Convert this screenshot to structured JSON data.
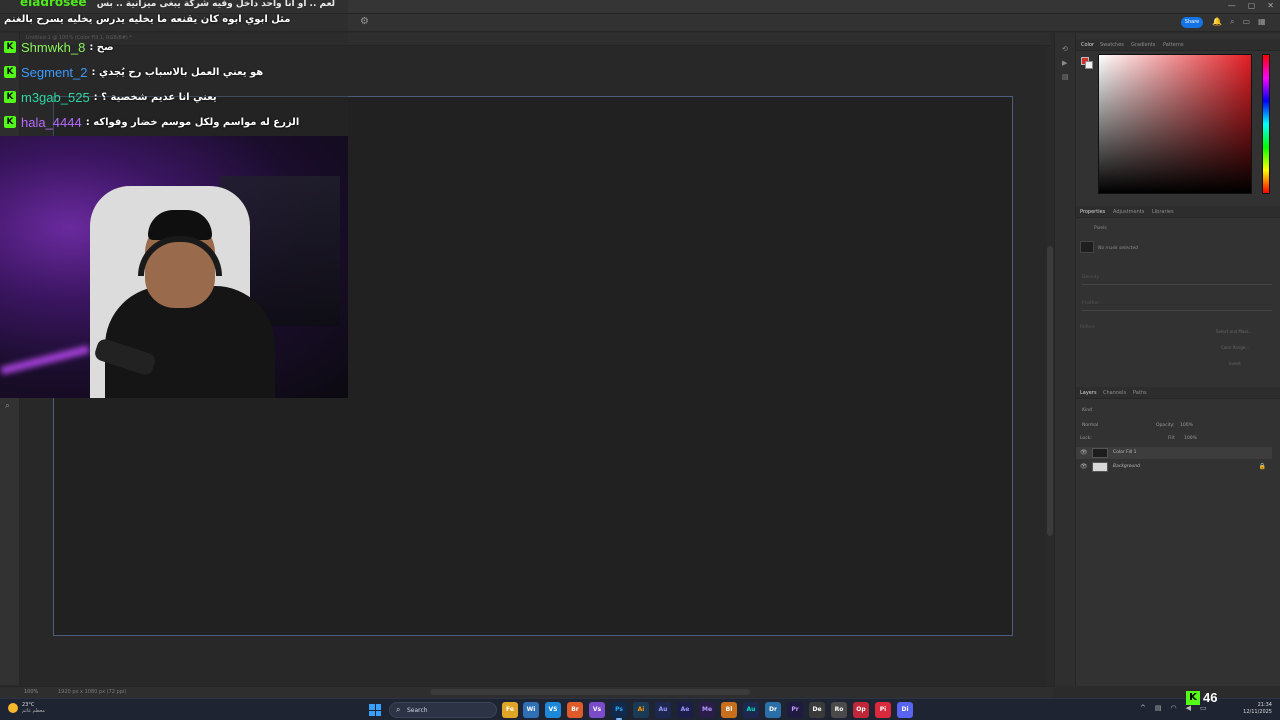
{
  "app": {
    "share_label": "Share",
    "doc_tab": "Untitled-1 @ 100% (Color Fill 1, RGB/8#) *"
  },
  "status": {
    "zoom": "100%",
    "dimensions": "1920 px x 1080 px (72 ppi)"
  },
  "panels": {
    "color_tabs": [
      "Color",
      "Swatches",
      "Gradients",
      "Patterns"
    ],
    "properties_tabs": [
      "Properties",
      "Adjustments",
      "Libraries"
    ],
    "properties_header": "Pixels",
    "no_mask": "No mask selected",
    "density": "Density",
    "feather": "Feather",
    "refine": "Refine:",
    "select_mask": "Select and Mask...",
    "color_range": "Color Range...",
    "invert": "Invert",
    "layers_tabs": [
      "Layers",
      "Channels",
      "Paths"
    ],
    "kind": "Kind",
    "blend_mode": "Normal",
    "opacity_label": "Opacity:",
    "opacity_value": "100%",
    "lock_label": "Lock:",
    "fill_label": "Fill:",
    "fill_value": "100%",
    "layers": [
      {
        "name": "Color Fill 1",
        "selected": true
      },
      {
        "name": "Background",
        "selected": false
      }
    ]
  },
  "chat": {
    "cut_top": "eladrosee",
    "cut_top_text": "لعم .. أو انا واحد داخل وفيه شركة يبغى ميزانية .. بس",
    "partial": "مثل ابوي ابوه كان يقنعه ما يخليه يدرس يخليه يسرح بالغنم",
    "messages": [
      {
        "user": "Shmwkh_8",
        "color": "#8bf25b",
        "text": ": صح"
      },
      {
        "user": "Segment_2",
        "color": "#3a9bff",
        "text": ": هو يعني العمل بالاسباب رح يُجدي"
      },
      {
        "user": "m3gab_525",
        "color": "#2fd6a3",
        "text": ": يعني انا عديم شخصية ؟"
      },
      {
        "user": "hala_4444",
        "color": "#b56bff",
        "text": ": الزرع له مواسم ولكل موسم خضار وفواكه"
      }
    ]
  },
  "taskbar": {
    "temperature": "23°C",
    "condition": "معظم غائم",
    "search_placeholder": "Search",
    "apps": [
      "Fe",
      "Wi",
      "VS",
      "Br",
      "Vs",
      "Ps",
      "Ai",
      "Au",
      "Ae",
      "Me",
      "Bl",
      "Au",
      "Dr",
      "Pr",
      "De",
      "Ro",
      "Op",
      "Pi",
      "Di"
    ],
    "time": "21:34",
    "date": "12/11/2025",
    "kick_viewers": "46"
  },
  "colors": {
    "kick_green": "#53fc18",
    "share_blue": "#1473e6",
    "fg_color": "#d32f2f"
  }
}
